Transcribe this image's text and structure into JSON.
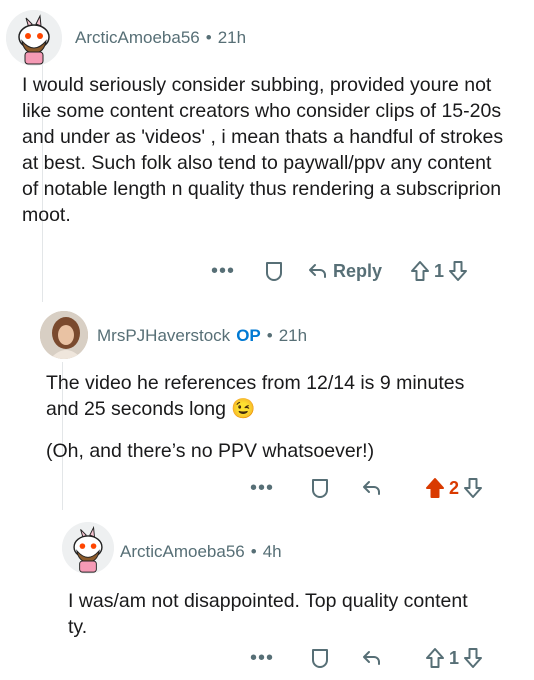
{
  "comments": [
    {
      "username": "ArcticAmoeba56",
      "op_badge": "",
      "time": "21h",
      "body": [
        "I would seriously consider subbing, provided youre not like some content creators who consider clips of 15-20s and under as 'videos' , i mean thats a handful of strokes at best. Such folk also tend to paywall/ppv any content of notable length n quality thus rendering a subscriprion moot."
      ],
      "reply_label": "Reply",
      "votes": "1",
      "upvoted": false
    },
    {
      "username": "MrsPJHaverstock",
      "op_badge": "OP",
      "time": "21h",
      "body": [
        "The video he references from 12/14 is 9 minutes and 25 seconds long",
        "(Oh, and there’s no PPV whatsoever!)"
      ],
      "emoji": "😉",
      "reply_label": "",
      "votes": "2",
      "upvoted": true
    },
    {
      "username": "ArcticAmoeba56",
      "op_badge": "",
      "time": "4h",
      "body": [
        "I was/am not disappointed. Top quality content ty."
      ],
      "reply_label": "",
      "votes": "1",
      "upvoted": false
    }
  ],
  "colors": {
    "meta": "#576f76",
    "op": "#0079d3",
    "upvote_active": "#d93a00",
    "thread_line": "#e3e6e8"
  },
  "icons": [
    "overflow-menu-icon",
    "award-icon",
    "reply-arrow-icon",
    "upvote-icon",
    "downvote-icon"
  ]
}
